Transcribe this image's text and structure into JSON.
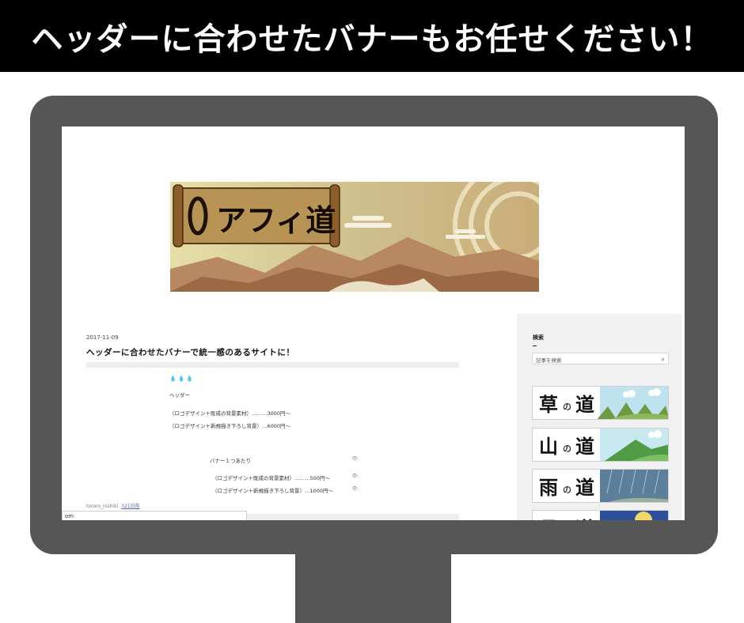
{
  "headline": "ヘッダーに合わせたバナーもお任せください！",
  "site": {
    "logo_text": "アフィ道"
  },
  "post": {
    "date": "2017-11-09",
    "title": "ヘッダーに合わせたバナーで統一感のあるサイトに！",
    "drops": "💧💧💧",
    "section_header": "ヘッダー",
    "header_lines": [
      "（ロゴデザイン＋既成の背景素材）………3000円〜",
      "（ロゴデザイン＋新規描き下ろし背景）…6000円〜"
    ],
    "banner_section": "バナー１つあたり",
    "banner_lines": [
      "（ロゴデザイン＋既成の背景素材）………500円〜",
      "（ロゴデザイン＋新規描き下ろし背景）…1000円〜"
    ],
    "author": "tororo_nishiki",
    "age": "321日前"
  },
  "statusbar": {
    "text": "om"
  },
  "sidebar": {
    "heading": "検索",
    "search_placeholder": "記事を検索",
    "banners": [
      {
        "kanji": "草",
        "no": "の",
        "michi": "道"
      },
      {
        "kanji": "山",
        "no": "の",
        "michi": "道"
      },
      {
        "kanji": "雨",
        "no": "の",
        "michi": "道"
      },
      {
        "kanji": "月",
        "no": "の",
        "michi": "道"
      }
    ]
  },
  "colors": {
    "headline_bg": "#000000",
    "monitor": "#565656",
    "sidebar_bg": "#f1f1f1"
  }
}
